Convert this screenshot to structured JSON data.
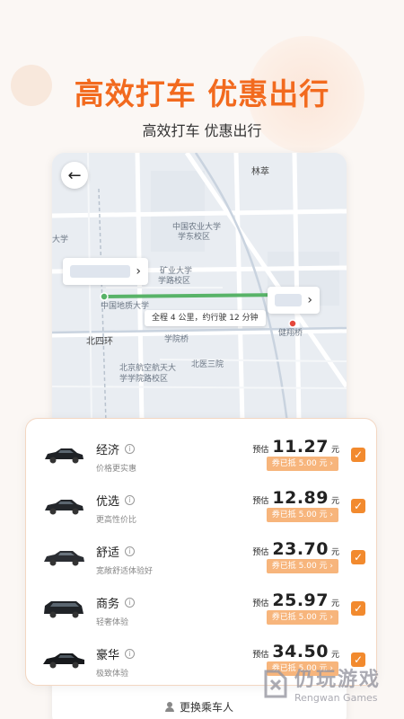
{
  "hero": {
    "title": "高效打车 优惠出行",
    "subtitle": "高效打车 优惠出行"
  },
  "map": {
    "labels": {
      "linCui": "林萃",
      "agri": "中国农业大学",
      "agri2": "学东校区",
      "mining": "矿业大学",
      "mining2": "学路校区",
      "daxue": "大学",
      "geo": "中国地质大学",
      "beisihuan": "北四环",
      "xueyuan": "学院桥",
      "beiyisan": "北医三院",
      "jianxiang": "健翔桥",
      "buaa": "北京航空航天大",
      "buaa2": "学学院路校区"
    },
    "route_pill": "全程 4 公里，约行驶 12 分钟"
  },
  "cars": [
    {
      "name": "经济",
      "desc": "价格更实惠",
      "est_label": "预估",
      "price": "11.27",
      "unit": "元",
      "coupon": "券已抵 5.00 元 ›"
    },
    {
      "name": "优选",
      "desc": "更高性价比",
      "est_label": "预估",
      "price": "12.89",
      "unit": "元",
      "coupon": "券已抵 5.00 元 ›"
    },
    {
      "name": "舒适",
      "desc": "宽敞舒适体验好",
      "est_label": "预估",
      "price": "23.70",
      "unit": "元",
      "coupon": "券已抵 5.00 元 ›"
    },
    {
      "name": "商务",
      "desc": "轻奢体验",
      "est_label": "预估",
      "price": "25.97",
      "unit": "元",
      "coupon": "券已抵 5.00 元 ›"
    },
    {
      "name": "豪华",
      "desc": "极致体验",
      "est_label": "预估",
      "price": "34.50",
      "unit": "元",
      "coupon": "券已抵 5.00 元 ›"
    }
  ],
  "switch_passenger": "更换乘车人",
  "watermark": {
    "cn": "仍玩游戏",
    "en": "Rengwan Games"
  },
  "colors": {
    "accent": "#f26a1e",
    "check": "#f28a2e",
    "coupon": "#f7b57c",
    "route": "#58b368"
  }
}
